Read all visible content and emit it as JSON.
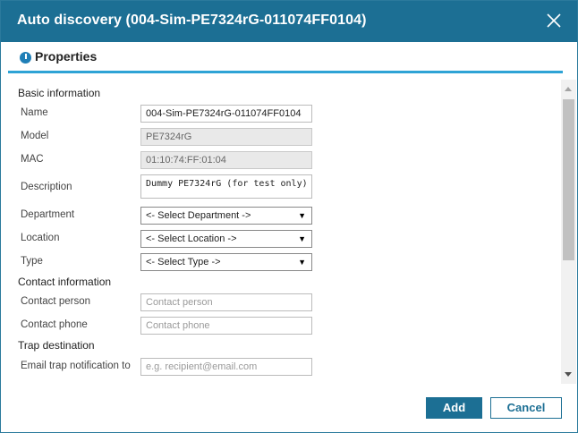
{
  "dialog": {
    "title": "Auto discovery (004-Sim-PE7324rG-011074FF0104)",
    "close_icon": "close-icon"
  },
  "section": {
    "icon": "info-icon",
    "label": "Properties"
  },
  "groups": {
    "basic": "Basic information",
    "contact": "Contact information",
    "trap": "Trap destination"
  },
  "fields": {
    "name": {
      "label": "Name",
      "value": "004-Sim-PE7324rG-011074FF0104"
    },
    "model": {
      "label": "Model",
      "value": "PE7324rG"
    },
    "mac": {
      "label": "MAC",
      "value": "01:10:74:FF:01:04"
    },
    "description": {
      "label": "Description",
      "value": "Dummy PE7324rG (for test only)"
    },
    "department": {
      "label": "Department",
      "value": "<- Select Department ->"
    },
    "location": {
      "label": "Location",
      "value": "<- Select Location ->"
    },
    "type": {
      "label": "Type",
      "value": "<- Select Type ->"
    },
    "contact_person": {
      "label": "Contact person",
      "placeholder": "Contact person"
    },
    "contact_phone": {
      "label": "Contact phone",
      "placeholder": "Contact phone"
    },
    "email_trap": {
      "label": "Email trap notification to",
      "placeholder": "e.g. recipient@email.com"
    }
  },
  "buttons": {
    "add": "Add",
    "cancel": "Cancel"
  },
  "colors": {
    "title_bar": "#1c6f94",
    "accent": "#2ea3d5"
  }
}
